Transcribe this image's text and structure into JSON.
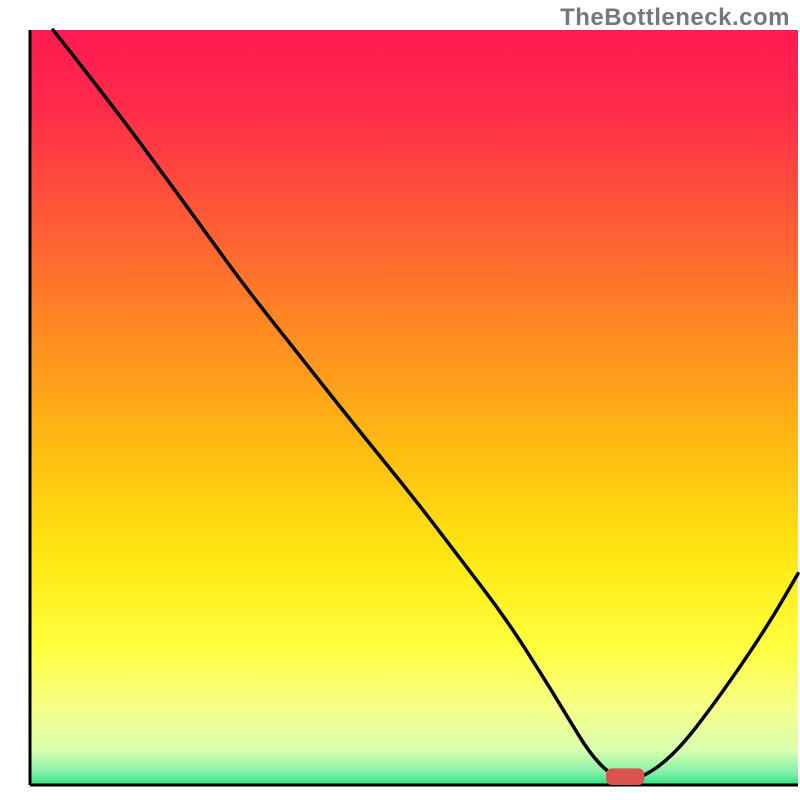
{
  "watermark": "TheBottleneck.com",
  "chart_data": {
    "type": "line",
    "title": "",
    "xlabel": "",
    "ylabel": "",
    "xlim": [
      0,
      100
    ],
    "ylim": [
      0,
      100
    ],
    "grid": false,
    "legend": false,
    "background_gradient": {
      "stops": [
        {
          "offset": 0.0,
          "color": "#ff1a52"
        },
        {
          "offset": 0.1,
          "color": "#ff2a4a"
        },
        {
          "offset": 0.25,
          "color": "#ff5a36"
        },
        {
          "offset": 0.4,
          "color": "#ff8a22"
        },
        {
          "offset": 0.55,
          "color": "#ffba12"
        },
        {
          "offset": 0.7,
          "color": "#ffe812"
        },
        {
          "offset": 0.82,
          "color": "#ffff40"
        },
        {
          "offset": 0.9,
          "color": "#f6ff8a"
        },
        {
          "offset": 0.955,
          "color": "#d8ffb0"
        },
        {
          "offset": 0.985,
          "color": "#7ef0a8"
        },
        {
          "offset": 1.0,
          "color": "#28e07a"
        }
      ]
    },
    "series": [
      {
        "name": "bottleneck-curve",
        "color": "#000000",
        "x": [
          3,
          10,
          18,
          23,
          28,
          35,
          42,
          50,
          56,
          62,
          67,
          70,
          73,
          76,
          79,
          84,
          90,
          96,
          100
        ],
        "y": [
          100,
          91,
          80,
          73,
          66,
          57,
          48,
          38,
          30,
          22,
          14,
          9,
          4,
          1,
          0.5,
          4,
          12,
          21,
          28
        ]
      }
    ],
    "marker": {
      "name": "optimal-marker",
      "color": "#d9534f",
      "x": 77.5,
      "y": 0,
      "width": 5,
      "height": 2.2
    },
    "axes": {
      "color": "#000000",
      "width": 3
    }
  }
}
